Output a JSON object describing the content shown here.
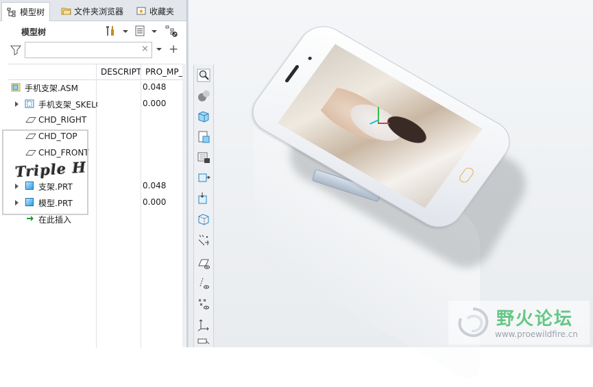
{
  "tabs": [
    {
      "label": "模型树",
      "icon": "model-tree-icon",
      "active": true
    },
    {
      "label": "文件夹浏览器",
      "icon": "folder-browser-icon",
      "active": false
    },
    {
      "label": "收藏夹",
      "icon": "favorites-icon",
      "active": false
    }
  ],
  "toolbar": {
    "title": "模型树"
  },
  "search": {
    "value": "",
    "placeholder": "",
    "clear": "×"
  },
  "columns": [
    "DESCRIPT",
    "PRO_MP_"
  ],
  "tree": [
    {
      "label": "手机支架.ASM",
      "value": "0.048",
      "icon": "assembly-icon",
      "expandable": false
    },
    {
      "label": "手机支架_SKELO",
      "value": "0.000",
      "icon": "skeleton-icon",
      "expandable": true
    },
    {
      "label": "CHD_RIGHT",
      "value": "",
      "icon": "datum-plane-icon",
      "expandable": false
    },
    {
      "label": "CHD_TOP",
      "value": "",
      "icon": "datum-plane-icon",
      "expandable": false
    },
    {
      "label": "CHD_FRONT",
      "value": "",
      "icon": "datum-plane-icon",
      "expandable": false
    },
    {
      "label": "支架.PRT",
      "value": "0.048",
      "icon": "part-icon",
      "expandable": true
    },
    {
      "label": "模型.PRT",
      "value": "0.000",
      "icon": "part-icon",
      "expandable": true
    },
    {
      "label": "在此插入",
      "value": "",
      "icon": "insert-here-icon",
      "expandable": false
    }
  ],
  "watermark": {
    "text": "Triple H"
  },
  "logo": {
    "title": "野火论坛",
    "url": "www.proewildfire.cn"
  },
  "colors": {
    "axis_x": "#e23b3b",
    "axis_y": "#2fbf47",
    "axis_z": "#22c0d8",
    "accent": "#2f9be3",
    "logo": "#55c27a"
  }
}
